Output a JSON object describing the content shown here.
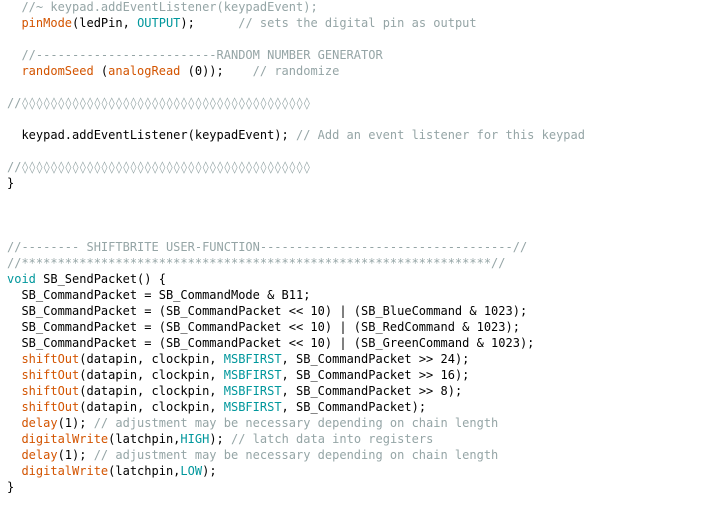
{
  "colors": {
    "background": "#FFFFFF",
    "plain": "#000000",
    "comment": "#95A5A6",
    "function": "#D35400",
    "keyword": "#00979C",
    "type": "#00979C",
    "constant": "#00979C"
  },
  "lines": [
    [
      {
        "t": "  ",
        "k": "plain"
      },
      {
        "t": "//~ keypad.addEventListener(keypadEvent);",
        "k": "comment"
      }
    ],
    [
      {
        "t": "  ",
        "k": "plain"
      },
      {
        "t": "pinMode",
        "k": "function"
      },
      {
        "t": "(ledPin, ",
        "k": "plain"
      },
      {
        "t": "OUTPUT",
        "k": "constant"
      },
      {
        "t": ");      ",
        "k": "plain"
      },
      {
        "t": "// sets the digital pin as output",
        "k": "comment"
      }
    ],
    [],
    [
      {
        "t": "  ",
        "k": "plain"
      },
      {
        "t": "//-------------------------RANDOM NUMBER GENERATOR",
        "k": "comment"
      }
    ],
    [
      {
        "t": "  ",
        "k": "plain"
      },
      {
        "t": "randomSeed",
        "k": "function"
      },
      {
        "t": " (",
        "k": "plain"
      },
      {
        "t": "analogRead",
        "k": "function"
      },
      {
        "t": " (0));    ",
        "k": "plain"
      },
      {
        "t": "// randomize",
        "k": "comment"
      }
    ],
    [],
    [
      {
        "t": "//◊◊◊◊◊◊◊◊◊◊◊◊◊◊◊◊◊◊◊◊◊◊◊◊◊◊◊◊◊◊◊◊◊◊◊◊◊◊◊◊",
        "k": "comment"
      }
    ],
    [],
    [
      {
        "t": "  keypad.addEventListener(keypadEvent); ",
        "k": "plain"
      },
      {
        "t": "// Add an event listener for this keypad",
        "k": "comment"
      }
    ],
    [],
    [
      {
        "t": "//◊◊◊◊◊◊◊◊◊◊◊◊◊◊◊◊◊◊◊◊◊◊◊◊◊◊◊◊◊◊◊◊◊◊◊◊◊◊◊◊",
        "k": "comment"
      }
    ],
    [
      {
        "t": "}",
        "k": "plain"
      }
    ],
    [],
    [],
    [],
    [
      {
        "t": "//-------- SHIFTBRITE USER-FUNCTION-----------------------------------//",
        "k": "comment"
      }
    ],
    [
      {
        "t": "//*****************************************************************//",
        "k": "comment"
      }
    ],
    [
      {
        "t": "void",
        "k": "type"
      },
      {
        "t": " SB_SendPacket() {",
        "k": "plain"
      }
    ],
    [
      {
        "t": "  SB_CommandPacket = SB_CommandMode & B11;",
        "k": "plain"
      }
    ],
    [
      {
        "t": "  SB_CommandPacket = (SB_CommandPacket << 10) | (SB_BlueCommand & 1023);",
        "k": "plain"
      }
    ],
    [
      {
        "t": "  SB_CommandPacket = (SB_CommandPacket << 10) | (SB_RedCommand & 1023);",
        "k": "plain"
      }
    ],
    [
      {
        "t": "  SB_CommandPacket = (SB_CommandPacket << 10) | (SB_GreenCommand & 1023);",
        "k": "plain"
      }
    ],
    [
      {
        "t": "  ",
        "k": "plain"
      },
      {
        "t": "shiftOut",
        "k": "function"
      },
      {
        "t": "(datapin, clockpin, ",
        "k": "plain"
      },
      {
        "t": "MSBFIRST",
        "k": "constant"
      },
      {
        "t": ", SB_CommandPacket >> 24);",
        "k": "plain"
      }
    ],
    [
      {
        "t": "  ",
        "k": "plain"
      },
      {
        "t": "shiftOut",
        "k": "function"
      },
      {
        "t": "(datapin, clockpin, ",
        "k": "plain"
      },
      {
        "t": "MSBFIRST",
        "k": "constant"
      },
      {
        "t": ", SB_CommandPacket >> 16);",
        "k": "plain"
      }
    ],
    [
      {
        "t": "  ",
        "k": "plain"
      },
      {
        "t": "shiftOut",
        "k": "function"
      },
      {
        "t": "(datapin, clockpin, ",
        "k": "plain"
      },
      {
        "t": "MSBFIRST",
        "k": "constant"
      },
      {
        "t": ", SB_CommandPacket >> 8);",
        "k": "plain"
      }
    ],
    [
      {
        "t": "  ",
        "k": "plain"
      },
      {
        "t": "shiftOut",
        "k": "function"
      },
      {
        "t": "(datapin, clockpin, ",
        "k": "plain"
      },
      {
        "t": "MSBFIRST",
        "k": "constant"
      },
      {
        "t": ", SB_CommandPacket);",
        "k": "plain"
      }
    ],
    [
      {
        "t": "  ",
        "k": "plain"
      },
      {
        "t": "delay",
        "k": "function"
      },
      {
        "t": "(1); ",
        "k": "plain"
      },
      {
        "t": "// adjustment may be necessary depending on chain length",
        "k": "comment"
      }
    ],
    [
      {
        "t": "  ",
        "k": "plain"
      },
      {
        "t": "digitalWrite",
        "k": "function"
      },
      {
        "t": "(latchpin,",
        "k": "plain"
      },
      {
        "t": "HIGH",
        "k": "constant"
      },
      {
        "t": "); ",
        "k": "plain"
      },
      {
        "t": "// latch data into registers",
        "k": "comment"
      }
    ],
    [
      {
        "t": "  ",
        "k": "plain"
      },
      {
        "t": "delay",
        "k": "function"
      },
      {
        "t": "(1); ",
        "k": "plain"
      },
      {
        "t": "// adjustment may be necessary depending on chain length",
        "k": "comment"
      }
    ],
    [
      {
        "t": "  ",
        "k": "plain"
      },
      {
        "t": "digitalWrite",
        "k": "function"
      },
      {
        "t": "(latchpin,",
        "k": "plain"
      },
      {
        "t": "LOW",
        "k": "constant"
      },
      {
        "t": ");",
        "k": "plain"
      }
    ],
    [
      {
        "t": "}",
        "k": "plain"
      }
    ]
  ]
}
